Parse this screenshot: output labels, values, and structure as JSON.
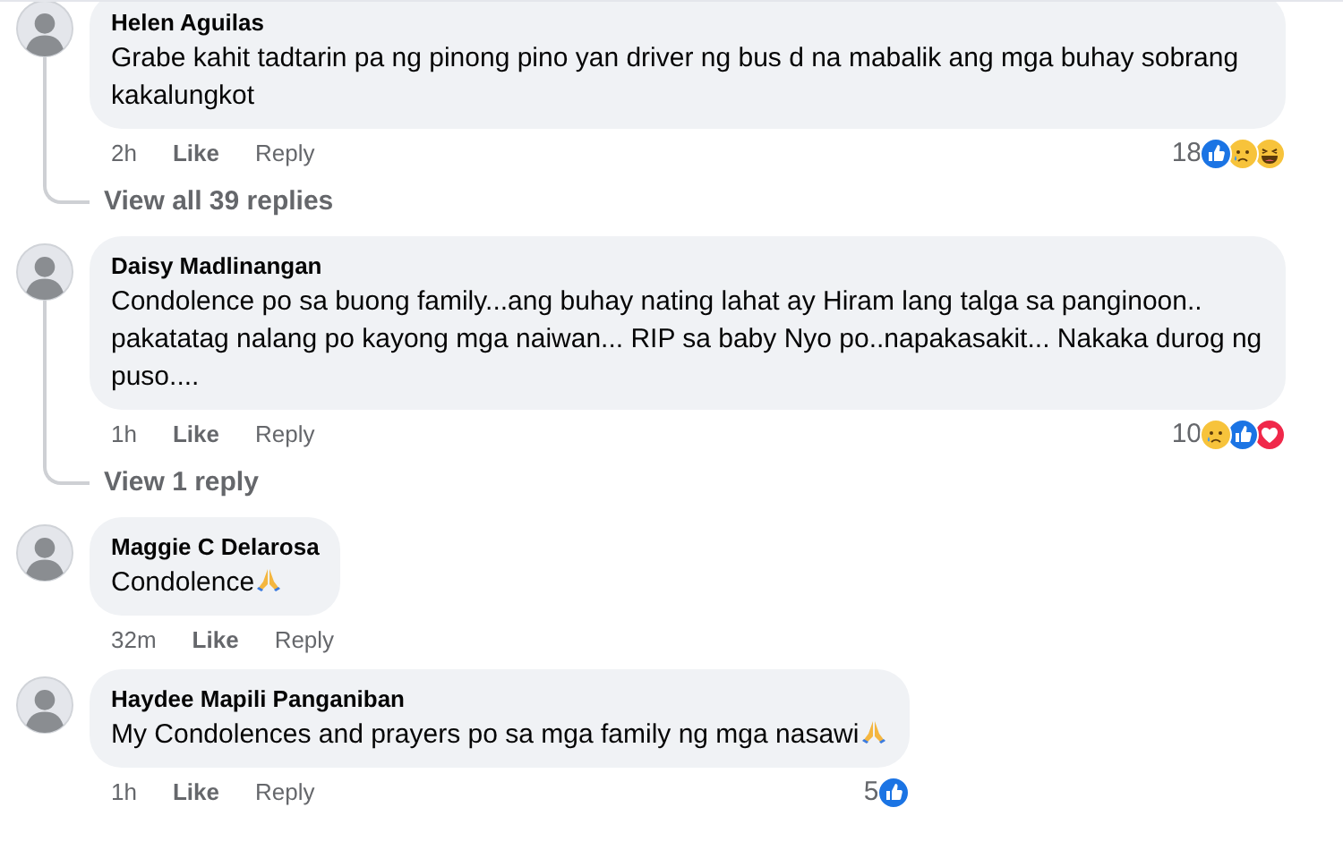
{
  "comments": [
    {
      "author": "Helen Aguilas",
      "text": "Grabe kahit tadtarin pa ng pinong pino yan driver ng bus d na mabalik ang mga buhay sobrang kakalungkot",
      "time": "2h",
      "like": "Like",
      "reply": "Reply",
      "reaction_count": "18",
      "reactions": [
        {
          "kind": "like"
        },
        {
          "kind": "sad"
        },
        {
          "kind": "haha"
        }
      ],
      "view_replies": "View all 39 replies"
    },
    {
      "author": "Daisy Madlinangan",
      "text": "Condolence po sa buong family...ang buhay nating lahat ay Hiram lang talga sa panginoon.. pakatatag nalang po kayong mga naiwan... RIP sa baby Nyo po..napakasakit... Nakaka durog ng puso....",
      "time": "1h",
      "like": "Like",
      "reply": "Reply",
      "reaction_count": "10",
      "reactions": [
        {
          "kind": "sad"
        },
        {
          "kind": "like"
        },
        {
          "kind": "love"
        }
      ],
      "view_replies": "View 1 reply"
    },
    {
      "author": "Maggie C Delarosa",
      "text": "Condolence",
      "trailing_emoji": {
        "kind": "praying-hands"
      },
      "time": "32m",
      "like": "Like",
      "reply": "Reply"
    },
    {
      "author": "Haydee Mapili Panganiban",
      "text": "My Condolences and prayers po sa mga family ng mga nasawi",
      "trailing_emoji": {
        "kind": "praying-hands"
      },
      "time": "1h",
      "like": "Like",
      "reply": "Reply",
      "reaction_count": "5",
      "reactions": [
        {
          "kind": "like"
        }
      ]
    }
  ]
}
